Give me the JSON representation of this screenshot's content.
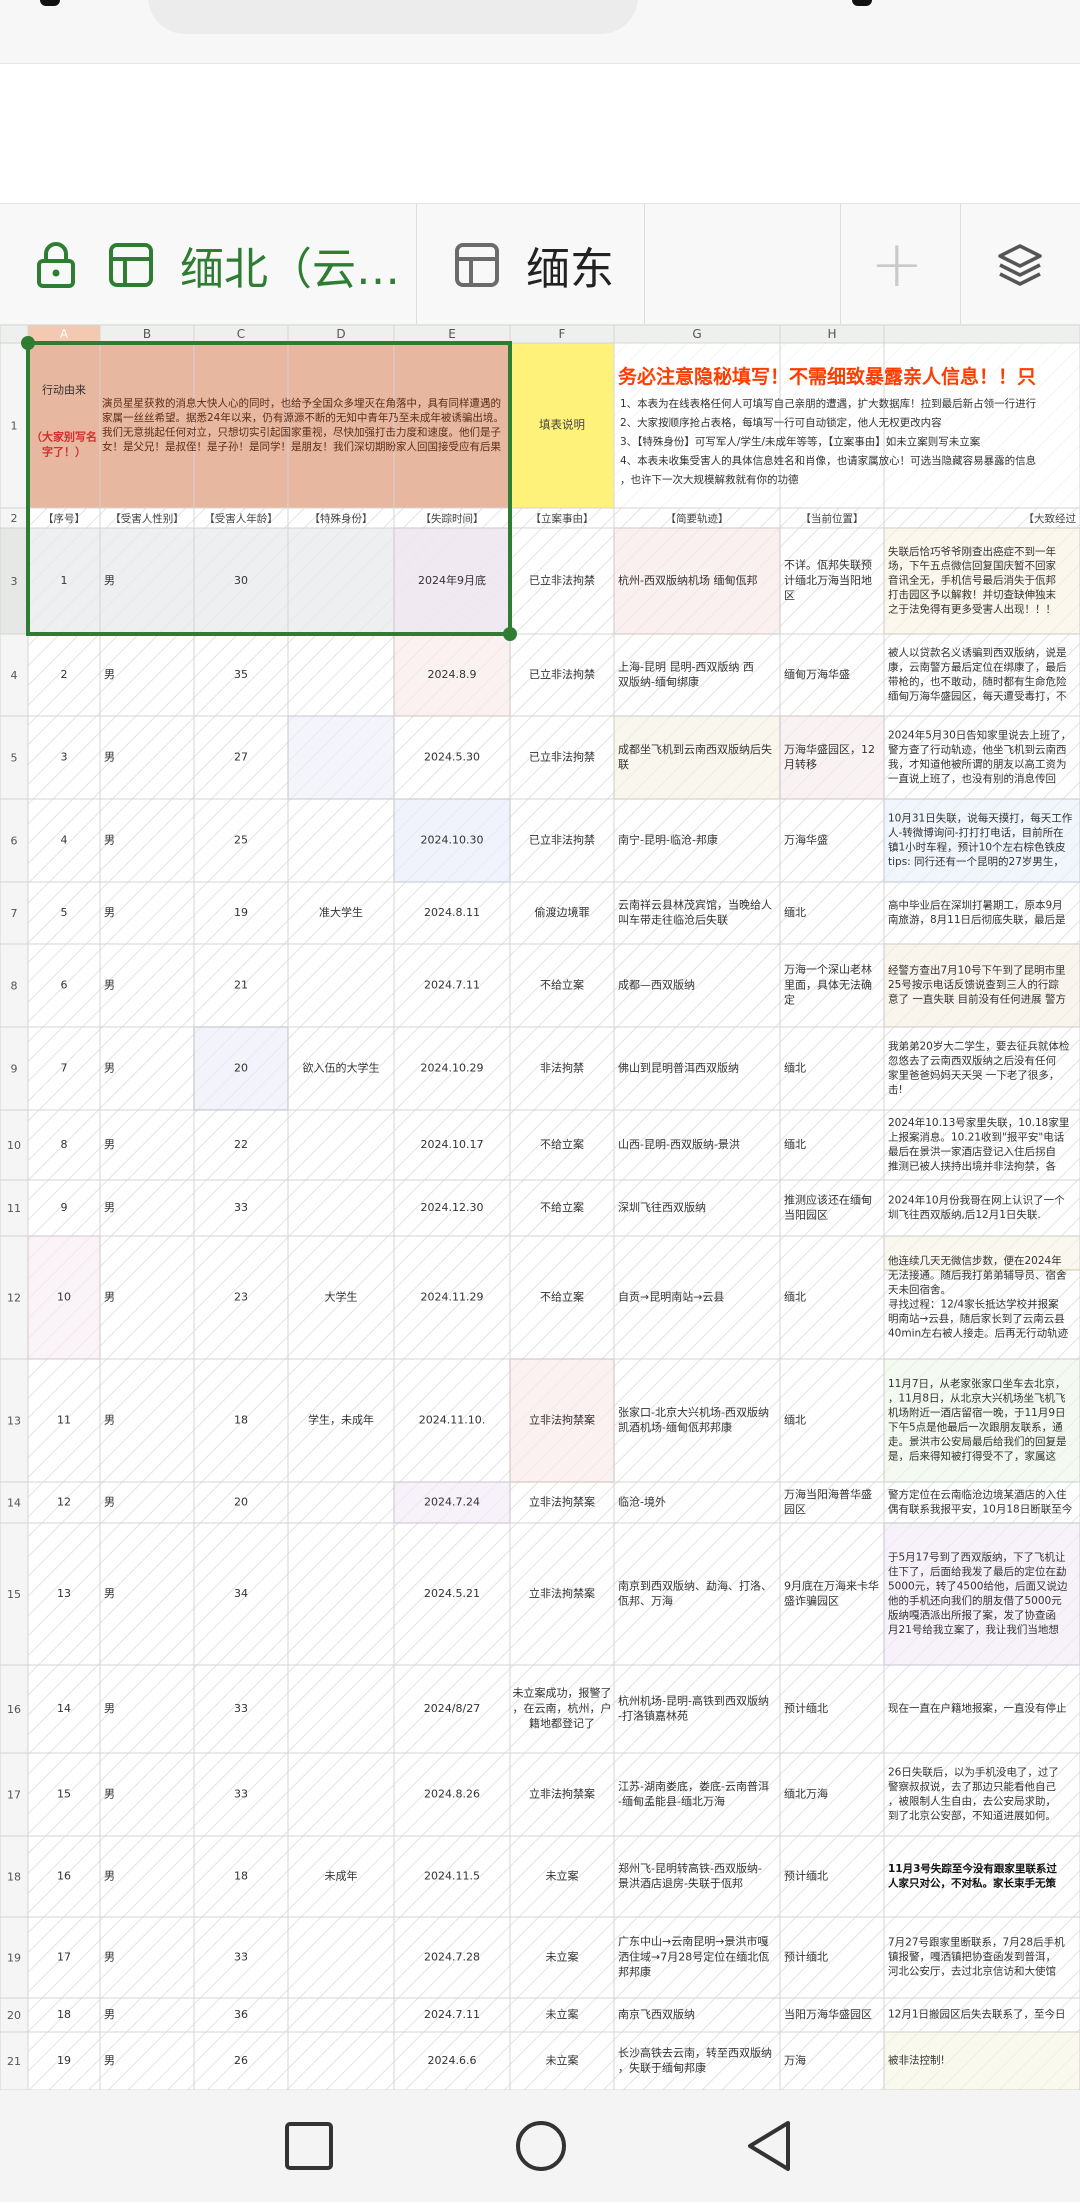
{
  "tabs": [
    {
      "label": "缅北（云…",
      "icon": "grid-icon",
      "locked": true,
      "active": true
    },
    {
      "label": "缅东",
      "icon": "grid-icon",
      "locked": false,
      "active": false
    }
  ],
  "add_tab": "+",
  "colors": {
    "accent_green": "#2e7d32",
    "header_orange": "#e8b79f",
    "note_yellow": "#fff27a",
    "grid_line": "#d4d4d4",
    "red_text": "#d32f2f"
  },
  "columns": [
    "",
    "A",
    "B",
    "C",
    "D",
    "E",
    "F",
    "G",
    "H",
    ""
  ],
  "row_numbers": [
    "1",
    "2",
    "3",
    "4",
    "5",
    "6",
    "7",
    "8",
    "9",
    "10",
    "11",
    "12",
    "13",
    "14",
    "15",
    "16",
    "17",
    "18",
    "19",
    "20",
    "21"
  ],
  "header_note": {
    "label1": "行动由来",
    "label2": "（大家别写名字了！）",
    "text": "演员星星获救的消息大快人心的同时，也给予全国众多埋灭在角落中，具有同样遭遇的家属一丝丝希望。据悉24年以来，仍有源源不断的无知中青年乃至未成年被诱骗出境。我们无意挑起任何对立，只想切实引起国家重视，尽快加强打击力度和速度。他们是子女！是父兄！是叔侄！是子孙！是同学！是朋友！我们深切期盼家人回国接受应有后果",
    "fill_label": "填表说明",
    "warning": "务必注意隐秘填写！不需细致暴露亲人信息！！只",
    "lines": [
      "1、本表为在线表格任何人可填写自己亲朋的遭遇，扩大数据库！拉到最后新占领一行进行",
      "2、大家按顺序抢占表格，每填写一行可自动锁定，他人无权更改内容",
      "3、【特殊身份】可写军人/学生/未成年等等，【立案事由】如未立案则写未立案",
      "4、本表未收集受害人的具体信息姓名和肖像，也请家属放心！可选当隐藏容易暴露的信息",
      "，也许下一次大规模解救就有你的功德"
    ]
  },
  "headers": [
    "【序号】",
    "【受害人性别】",
    "【受害人年龄】",
    "【特殊身份】",
    "【失踪时间】",
    "【立案事由】",
    "【简要轨迹】",
    "【当前位置】",
    "【大致经过"
  ],
  "rows": [
    {
      "n": "1",
      "sex": "男",
      "age": "30",
      "id": "",
      "time": "2024年9月底",
      "case": "已立非法拘禁",
      "track": "杭州-西双版纳机场 缅甸佤邦",
      "loc": "不详。佤邦失联预计缅北万海当阳地区",
      "detail": "失联后恰巧爷爷刚查出癌症不到一年\n场，下午五点微信回复国庆暂不回家\n音讯全无，手机信号最后消失于佤邦\n打击园区予以解救！并切查缺伸独末\n之于法免得有更多受害人出现！！！"
    },
    {
      "n": "2",
      "sex": "男",
      "age": "35",
      "id": "",
      "time": "2024.8.9",
      "case": "已立非法拘禁",
      "track": "上海-昆明 昆明-西双版纳 西双版纳-缅甸绑康",
      "loc": "缅甸万海华盛",
      "detail": "被人以贷款名义诱骗到西双版纳，说是\n康，云南警方最后定位在绑康了，最后\n带枪的，也不敢动，随时都有生命危险\n缅甸万海华盛园区，每天遭受毒打，不"
    },
    {
      "n": "3",
      "sex": "男",
      "age": "27",
      "id": "",
      "time": "2024.5.30",
      "case": "已立非法拘禁",
      "track": "成都坐飞机到云南西双版纳后失联",
      "loc": "万海华盛园区，12月转移",
      "detail": "2024年5月30日告知家里说去上班了，\n警方查了行动轨迹，他坐飞机到云南西\n我，才知道他被所谓的朋友以高工资为\n一直说上班了，也没有别的消息传回"
    },
    {
      "n": "4",
      "sex": "男",
      "age": "25",
      "id": "",
      "time": "2024.10.30",
      "case": "已立非法拘禁",
      "track": "南宁-昆明-临沧-邦康",
      "loc": "万海华盛",
      "detail": "10月31日失联，说每天摸打，每天工作\n人-转微博询问-打打打电话，目前所在\n镇1小时车程，预计10个左右棕色铁皮\ntips: 同行还有一个昆明的27岁男生，"
    },
    {
      "n": "5",
      "sex": "男",
      "age": "19",
      "id": "准大学生",
      "time": "2024.8.11",
      "case": "偷渡边境罪",
      "track": "云南祥云县林茂宾馆，当晚给人叫车带走往临沧后失联",
      "loc": "缅北",
      "detail": "高中毕业后在深圳打暑期工，原本9月\n南旅游，8月11日后彻底失联，最后是"
    },
    {
      "n": "6",
      "sex": "男",
      "age": "21",
      "id": "",
      "time": "2024.7.11",
      "case": "不给立案",
      "track": "成都—西双版纳",
      "loc": "万海一个深山老林里面，具体无法确定",
      "detail": "经警方查出7月10号下午到了昆明市里\n25号按示电话反馈说查到三人的行踪\n意了 一直失联 目前没有任何进展 警方"
    },
    {
      "n": "7",
      "sex": "男",
      "age": "20",
      "id": "欲入伍的大学生",
      "time": "2024.10.29",
      "case": "非法拘禁",
      "track": "佛山到昆明普洱西双版纳",
      "loc": "缅北",
      "detail": "我弟弟20岁大二学生，要去征兵就体检\n忽悠去了云南西双版纳之后没有任何\n家里爸爸妈妈天天哭 一下老了很多，\n击!"
    },
    {
      "n": "8",
      "sex": "男",
      "age": "22",
      "id": "",
      "time": "2024.10.17",
      "case": "不给立案",
      "track": "山西-昆明-西双版纳-景洪",
      "loc": "缅北",
      "detail": "2024年10.13号家里失联，10.18家里\n上报案消息。10.21收到\"报平安\"电话\n最后在景洪一家酒店登记入住后拐自\n推测已被人挟持出境并非法拘禁，各"
    },
    {
      "n": "9",
      "sex": "男",
      "age": "33",
      "id": "",
      "time": "2024.12.30",
      "case": "不给立案",
      "track": "深圳飞往西双版纳",
      "loc": "推测应该还在缅甸当阳园区",
      "detail": "2024年10月份我哥在网上认识了一个\n圳飞往西双版纳,后12月1日失联."
    },
    {
      "n": "10",
      "sex": "男",
      "age": "23",
      "id": "大学生",
      "time": "2024.11.29",
      "case": "不给立案",
      "track": "自贡→昆明南站→云县",
      "loc": "缅北",
      "detail": "他连续几天无微信步数，便在2024年\n无法接通。随后我打弟弟辅导员、宿舍\n天未回宿舍。\n寻找过程：12/4家长抵达学校并报案\n明南站→云县，随后家长到了云南云县\n40min左右被人接走。后再无行动轨迹"
    },
    {
      "n": "11",
      "sex": "男",
      "age": "18",
      "id": "学生，未成年",
      "time": "2024.11.10.",
      "case": "立非法拘禁案",
      "track": "张家口-北京大兴机场-西双版纳凯酒机场-缅甸佤邦邦康",
      "loc": "缅北",
      "detail": "11月7日，从老家张家口坐车去北京，\n，11月8日，从北京大兴机场坐飞机飞\n机场附近一酒店留宿一晚，于11月9日\n下午5点是他最后一次跟朋友联系，通\n走。景洪市公安局最后给我们的回复是\n是，后来得知被打得受不了，家属这"
    },
    {
      "n": "12",
      "sex": "男",
      "age": "20",
      "id": "",
      "time": "2024.7.24",
      "case": "立非法拘禁案",
      "track": "临沧-境外",
      "loc": "万海当阳海普华盛园区",
      "detail": "警方定位在云南临沧边境某酒店的入住\n偶有联系我报平安，10月18日断联至今"
    },
    {
      "n": "13",
      "sex": "男",
      "age": "34",
      "id": "",
      "time": "2024.5.21",
      "case": "立非法拘禁案",
      "track": "南京到西双版纳、勐海、打洛、佤邦、万海",
      "loc": "9月底在万海来卡华盛诈骗园区",
      "detail": "于5月17号到了西双版纳，下了飞机让\n住下了，后面给我发了最后的定位在勐\n5000元，转了4500给他，后面又说边\n他的手机还向我们的朋友借了5000元\n版纳嘎洒派出所报了案，发了协查函\n月21号给我立案了，我让我们当地想"
    },
    {
      "n": "14",
      "sex": "男",
      "age": "33",
      "id": "",
      "time": "2024/8/27",
      "case": "未立案成功，报警了，在云南，杭州，户籍地都登记了",
      "track": "杭州机场-昆明-高铁到西双版纳-打洛镇嘉林苑",
      "loc": "预计缅北",
      "detail": "现在一直在户籍地报案，一直没有停止"
    },
    {
      "n": "15",
      "sex": "男",
      "age": "33",
      "id": "",
      "time": "2024.8.26",
      "case": "立非法拘禁案",
      "track": "江苏-湖南娄底，娄底-云南普洱-缅甸孟能县-缅北万海",
      "loc": "缅北万海",
      "detail": "26日失联后，以为手机没电了，过了\n警察叔叔说，去了那边只能看他自己\n，被限制人生自由，去公安局求助，\n到了北京公安部，不知道进展如何。"
    },
    {
      "n": "16",
      "sex": "男",
      "age": "18",
      "id": "未成年",
      "time": "2024.11.5",
      "case": "未立案",
      "track": "郑州飞-昆明转高铁-西双版纳-景洪酒店退房-失联于佤邦",
      "loc": "预计缅北",
      "detail": "11月3号失踪至今没有跟家里联系过\n人家只对公，不对私。家长束手无策"
    },
    {
      "n": "17",
      "sex": "男",
      "age": "33",
      "id": "",
      "time": "2024.7.28",
      "case": "未立案",
      "track": "广东中山→云南昆明→景洪市嘎洒住域→7月28号定位在缅北佤邦邦康",
      "loc": "预计缅北",
      "detail": "7月27号跟家里断联系，7月28后手机\n镇报警，嘎洒镇把协查函发到普洱，\n河北公安厅，去过北京信访和大使馆"
    },
    {
      "n": "18",
      "sex": "男",
      "age": "36",
      "id": "",
      "time": "2024.7.11",
      "case": "未立案",
      "track": "南京飞西双版纳",
      "loc": "当阳万海华盛园区",
      "detail": "12月1日搬园区后失去联系了，至今日"
    },
    {
      "n": "19",
      "sex": "男",
      "age": "26",
      "id": "",
      "time": "2024.6.6",
      "case": "未立案",
      "track": "长沙高铁去云南，转至西双版纳，失联于缅甸邦康",
      "loc": "万海",
      "detail": "被非法控制!"
    }
  ]
}
